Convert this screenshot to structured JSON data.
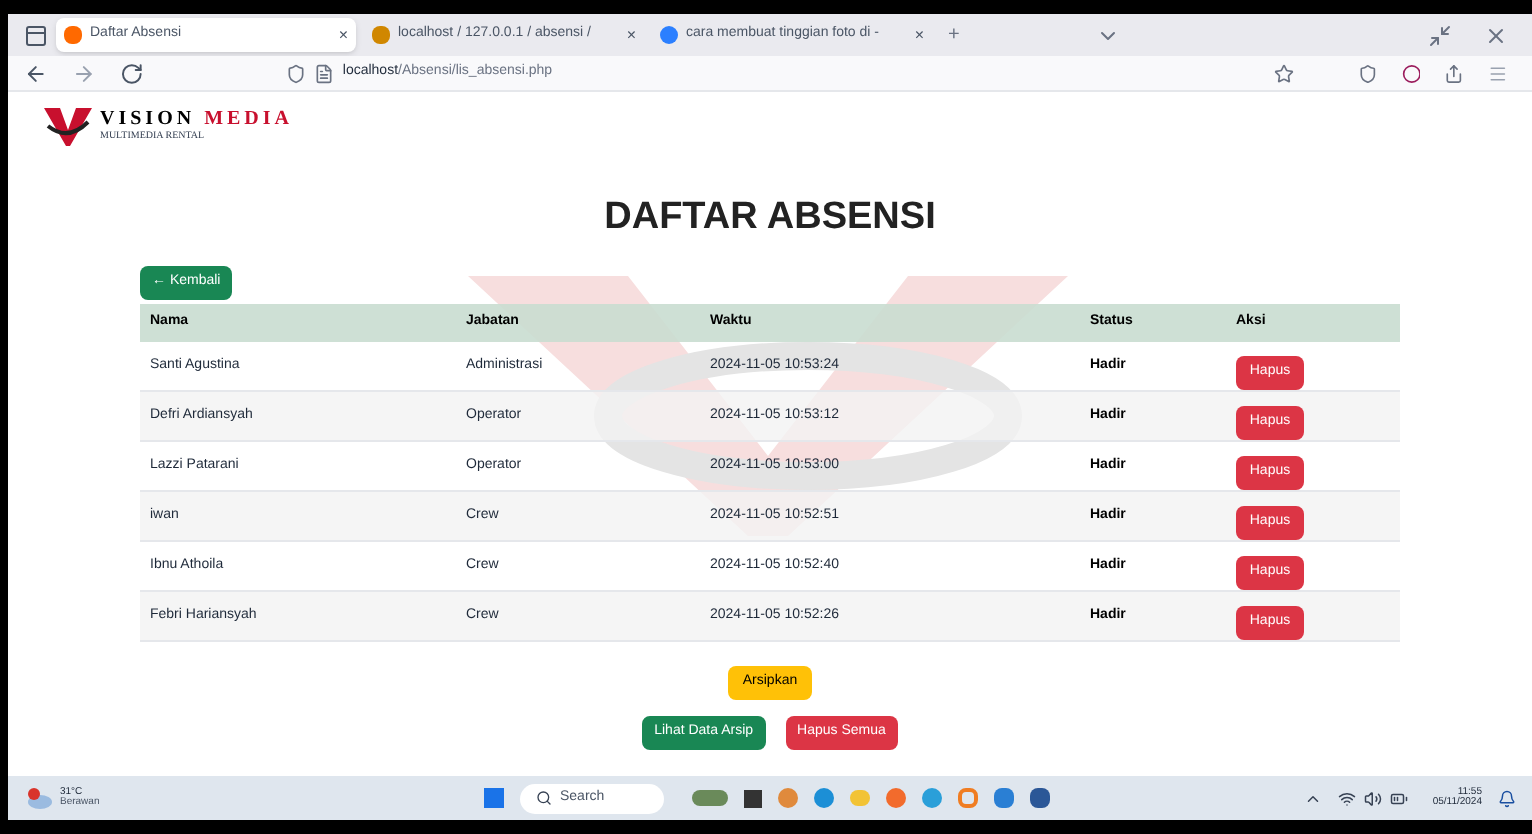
{
  "browser": {
    "tabs": [
      {
        "title": "Daftar Absensi",
        "close": "×",
        "selected": true
      },
      {
        "title": "localhost / 127.0.0.1 / absensi / ",
        "close": "×",
        "selected": false
      },
      {
        "title": "cara membuat tinggian foto di -",
        "close": "×",
        "selected": false
      }
    ],
    "new_tab": "+",
    "url_host": "localhost",
    "url_path": "/Absensi/lis_absensi.php"
  },
  "logo": {
    "name_1": "VISION",
    "name_2": "MEDIA",
    "tagline": "MULTIMEDIA RENTAL"
  },
  "title": "DAFTAR ABSENSI",
  "back_button": "← Kembali",
  "table": {
    "columns": [
      "Nama",
      "Jabatan",
      "Waktu",
      "Status",
      "Aksi"
    ],
    "rows": [
      {
        "nama": "Santi Agustina",
        "jabatan": "Administrasi",
        "waktu": "2024-11-05 10:53:24",
        "status": "Hadir",
        "action": "Hapus"
      },
      {
        "nama": "Defri Ardiansyah",
        "jabatan": "Operator",
        "waktu": "2024-11-05 10:53:12",
        "status": "Hadir",
        "action": "Hapus"
      },
      {
        "nama": "Lazzi Patarani",
        "jabatan": "Operator",
        "waktu": "2024-11-05 10:53:00",
        "status": "Hadir",
        "action": "Hapus"
      },
      {
        "nama": "iwan",
        "jabatan": "Crew",
        "waktu": "2024-11-05 10:52:51",
        "status": "Hadir",
        "action": "Hapus"
      },
      {
        "nama": "Ibnu Athoila",
        "jabatan": "Crew",
        "waktu": "2024-11-05 10:52:40",
        "status": "Hadir",
        "action": "Hapus"
      },
      {
        "nama": "Febri Hariansyah",
        "jabatan": "Crew",
        "waktu": "2024-11-05 10:52:26",
        "status": "Hadir",
        "action": "Hapus"
      }
    ]
  },
  "archive_button": "Arsipkan",
  "view_archive_button": "Lihat Data Arsip",
  "delete_all_button": "Hapus Semua",
  "taskbar": {
    "temperature": "31°C",
    "weather": "Berawan",
    "search_placeholder": "Search",
    "time": "11:55",
    "date": "05/11/2024"
  }
}
